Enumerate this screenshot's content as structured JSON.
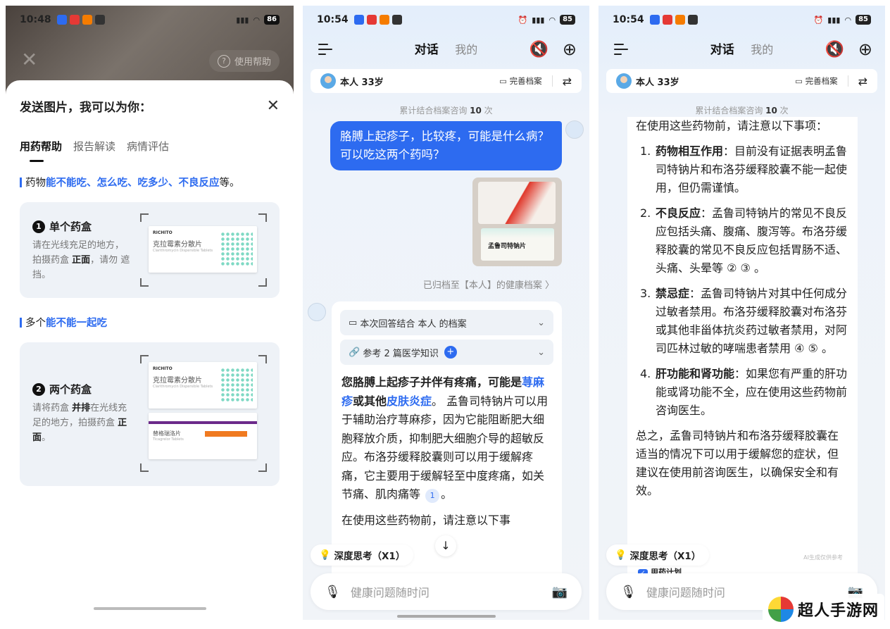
{
  "screen1": {
    "time": "10:48",
    "battery": "86",
    "help_label": "使用帮助",
    "sheet_title": "发送图片，我可以为你：",
    "tabs": [
      "用药帮助",
      "报告解读",
      "病情评估"
    ],
    "section1": {
      "prefix": "药物",
      "highlight": "能不能吃、怎么吃、吃多少、不良反应",
      "suffix": "等。"
    },
    "card1": {
      "number": "1",
      "title": "单个药盒",
      "desc_a": "请在光线充足的地方，拍摄药盒 ",
      "desc_bold": "正面",
      "desc_b": "，请勿 遮挡。"
    },
    "section2": {
      "prefix": "多个",
      "highlight": "能不能一起吃"
    },
    "card2": {
      "number": "2",
      "title": "两个药盒",
      "desc_a": "请将药盒 ",
      "desc_bold": "并排",
      "desc_b": "在光线充足的地方，拍摄药盒 ",
      "desc_bold2": "正面",
      "desc_c": "。"
    },
    "sample_box": {
      "brand": "RICHITO",
      "name": "克拉霉素分散片",
      "sub": "Clarithromycin Dispersible Tablets"
    },
    "sample_box2": {
      "name": "替格瑞洛片",
      "sub": "Ticagrelor Tablets"
    }
  },
  "screen2": {
    "time": "10:54",
    "battery": "85",
    "tab_active": "对话",
    "tab_other": "我的",
    "profile_name": "本人 33岁",
    "profile_action": "完善档案",
    "counter_prefix": "累计结合档案咨询 ",
    "counter_num": "10",
    "counter_suffix": " 次",
    "user_message": "胳膊上起疹子，比较疼，可能是什么病？可以吃这两个药吗？",
    "photo_label": "孟鲁司特钠片",
    "archived_note": "已归档至【本人】的健康档案 〉",
    "ref1": "本次回答结合 本人 的档案",
    "ref2": "参考 2 篇医学知识",
    "answer_head_a": "您胳膊上起疹子并伴有疼痛，可能是",
    "answer_link1": "荨麻疹",
    "answer_mid": "或其他",
    "answer_link2": "皮肤炎症",
    "answer_body": "。 孟鲁司特钠片可以用于辅助治疗荨麻疹，因为它能阻断肥大细胞释放介质，抑制肥大细胞介导的超敏反应。布洛芬缓释胶囊则可以用于缓解疼痛，它主要用于缓解轻至中度疼痛，如关节痛、肌肉痛等",
    "answer_cite": "1",
    "answer_next": "在使用这些药物前，请注意以下事",
    "deep_think": "深度思考（X1）",
    "input_placeholder": "健康问题随时问"
  },
  "screen3": {
    "time": "10:54",
    "battery": "85",
    "intro": "在使用这些药物前，请注意以下事项：",
    "items": [
      {
        "n": "1.",
        "title": "药物相互作用",
        "text": "：目前没有证据表明孟鲁司特钠片和布洛芬缓释胶囊不能一起使用，但仍需谨慎。"
      },
      {
        "n": "2.",
        "title": "不良反应",
        "text": "：孟鲁司特钠片的常见不良反应包括头痛、腹痛、腹泻等。布洛芬缓释胶囊的常见不良反应包括胃肠不适、头痛、头晕等 ② ③ 。"
      },
      {
        "n": "3.",
        "title": "禁忌症",
        "text": "：孟鲁司特钠片对其中任何成分过敏者禁用。布洛芬缓释胶囊对布洛芬或其他非甾体抗炎药过敏者禁用，对阿司匹林过敏的哮喘患者禁用 ④ ⑤ 。"
      },
      {
        "n": "4.",
        "title": "肝功能和肾功能",
        "text": "：如果您有严重的肝功能或肾功能不全，应在使用这些药物前咨询医生。"
      }
    ],
    "conclusion": "总之，孟鲁司特钠片和布洛芬缓释胶囊在适当的情况下可以用于缓解您的症状，但建议在使用前咨询医生，以确保安全和有效。",
    "disclaimer": "AI生成仅供参考",
    "plan": "用药计划"
  },
  "watermark": "超人手游网",
  "colors": {
    "accent": "#2d6bf0",
    "bubble": "#2d6bf0"
  }
}
